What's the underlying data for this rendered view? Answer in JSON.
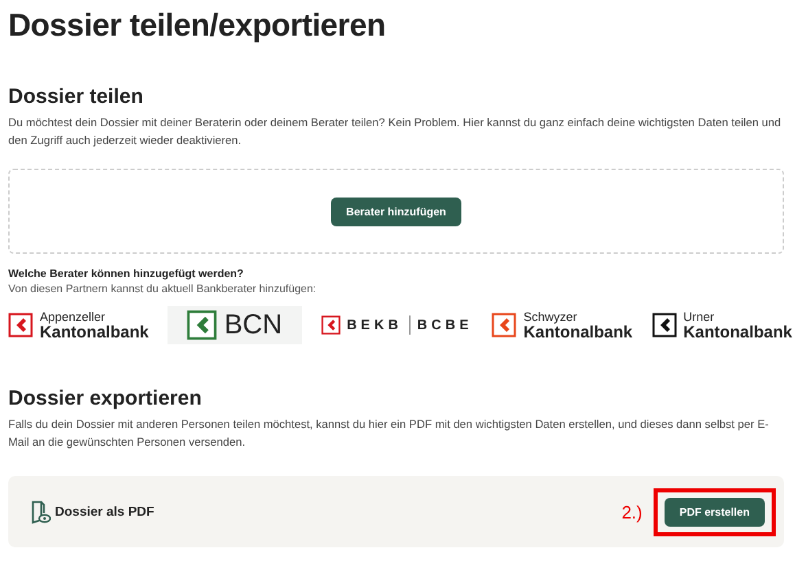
{
  "title": "Dossier teilen/exportieren",
  "share": {
    "heading": "Dossier teilen",
    "text": "Du möchtest dein Dossier mit deiner Beraterin oder deinem Berater teilen? Kein Problem. Hier kannst du ganz einfach deine wichtigsten Daten teilen und den Zugriff auch jederzeit wieder deaktivieren.",
    "button": "Berater hinzufügen",
    "question": "Welche Berater können hinzugefügt werden?",
    "hint": "Von diesen Partnern kannst du aktuell Bankberater hinzufügen:"
  },
  "partners": [
    {
      "kind": "stacked",
      "texts": [
        "Appenzeller",
        "Kantonalbank"
      ],
      "color": "#d7161e"
    },
    {
      "kind": "boxed",
      "texts": [
        "BCN"
      ],
      "color": "#2e7d3a"
    },
    {
      "kind": "split",
      "texts": [
        "BEKB",
        "BCBE"
      ],
      "color": "#d7161e"
    },
    {
      "kind": "stacked",
      "texts": [
        "Schwyzer",
        "Kantonalbank"
      ],
      "color": "#e8471c"
    },
    {
      "kind": "stacked",
      "texts": [
        "Urner",
        "Kantonalbank"
      ],
      "color": "#111111"
    }
  ],
  "export": {
    "heading": "Dossier exportieren",
    "text": "Falls du dein Dossier mit anderen Personen teilen möchtest, kannst du hier ein PDF mit den wichtigsten Daten erstellen, und dieses dann selbst per E-Mail an die gewünschten Personen versenden.",
    "item": "Dossier als PDF",
    "annotation": "2.)",
    "button": "PDF erstellen",
    "highlighted": true
  }
}
